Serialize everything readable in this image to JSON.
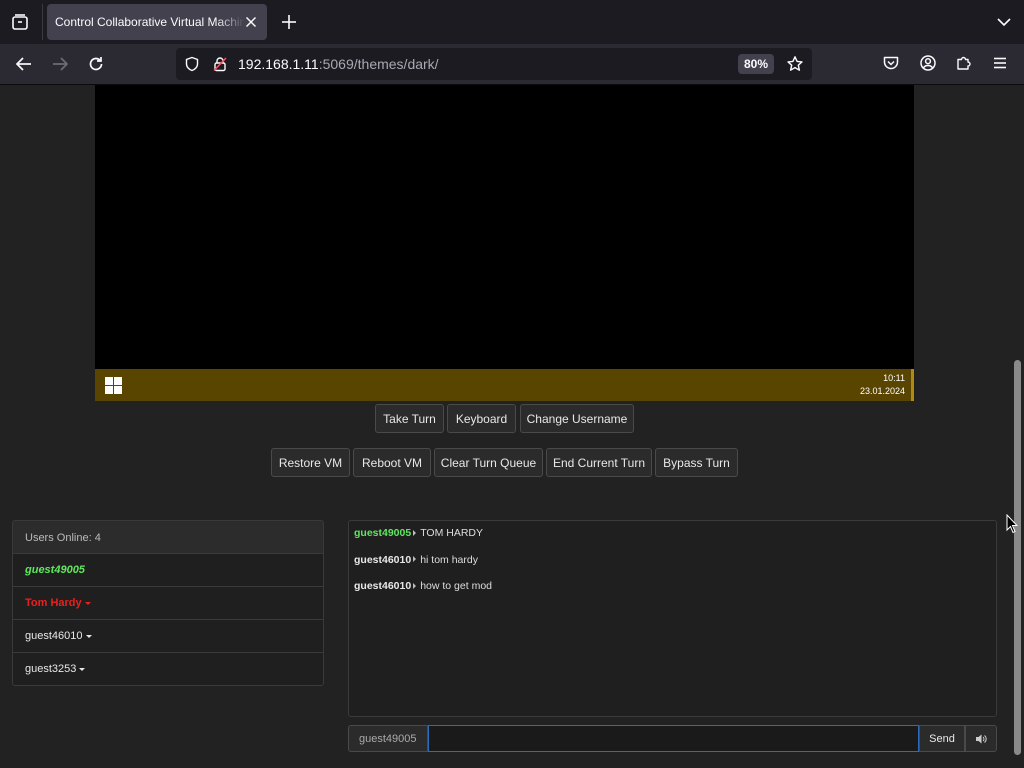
{
  "browser": {
    "tab_title": "Control Collaborative Virtual Machine",
    "url_host": "192.168.1.11",
    "url_path": ":5069/themes/dark/",
    "zoom": "80%"
  },
  "vm": {
    "clock_time": "10:11",
    "clock_date": "23.01.2024",
    "taskbar_color": "#5a4500"
  },
  "controls": {
    "row1": [
      "Take Turn",
      "Keyboard",
      "Change Username"
    ],
    "row2": [
      "Restore VM",
      "Reboot VM",
      "Clear Turn Queue",
      "End Current Turn",
      "Bypass Turn"
    ]
  },
  "users": {
    "header": "Users Online: 4",
    "list": [
      {
        "name": "guest49005",
        "color": "#5ee85e",
        "style": "self"
      },
      {
        "name": "Tom Hardy",
        "color": "#e82020",
        "style": "admin"
      },
      {
        "name": "guest46010",
        "color": "#e8e8e8",
        "style": "normal"
      },
      {
        "name": "guest3253",
        "color": "#e8e8e8",
        "style": "normal"
      }
    ]
  },
  "chat": {
    "messages": [
      {
        "user": "guest49005",
        "user_color": "#5ee85e",
        "text": "TOM HARDY"
      },
      {
        "user": "guest46010",
        "user_color": "#e8e8e8",
        "text": "hi tom hardy"
      },
      {
        "user": "guest46010",
        "user_color": "#e8e8e8",
        "text": "how to get mod"
      }
    ],
    "username": "guest49005",
    "input_value": "",
    "send_label": "Send"
  }
}
